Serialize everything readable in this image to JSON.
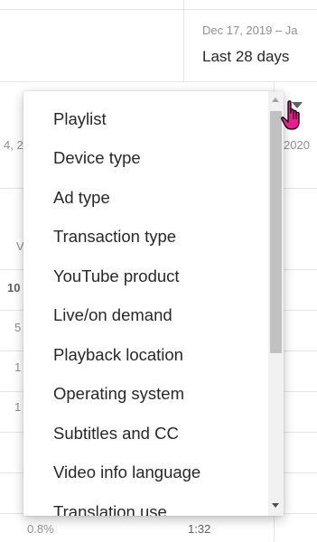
{
  "header": {
    "date_range": "Dec 17, 2019 – Ja",
    "period": "Last 28 days"
  },
  "table": {
    "left_date_fragment": "4, 2",
    "right_date_fragment": "2020",
    "row_fragments": [
      "V",
      "10",
      "5",
      "1",
      "1"
    ],
    "footer_pct": "0.8%",
    "footer_time": "1:32"
  },
  "dropdown": {
    "items": [
      "Playlist",
      "Device type",
      "Ad type",
      "Transaction type",
      "YouTube product",
      "Live/on demand",
      "Playback location",
      "Operating system",
      "Subtitles and CC",
      "Video info language",
      "Translation use"
    ]
  },
  "colors": {
    "pointer": "#e91e8c"
  }
}
